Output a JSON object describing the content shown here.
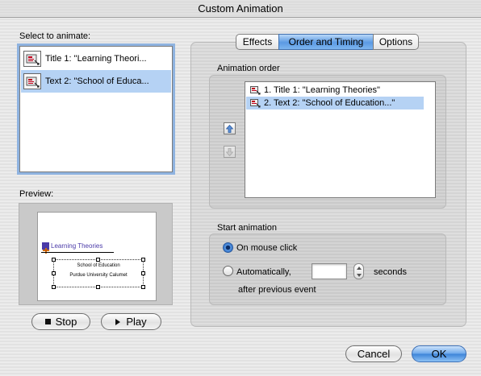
{
  "window": {
    "title": "Custom Animation"
  },
  "select": {
    "label": "Select to animate:",
    "items": [
      {
        "label": "Title 1: \"Learning Theori...",
        "selected": false
      },
      {
        "label": "Text 2: \"School of Educa...",
        "selected": true
      }
    ]
  },
  "preview": {
    "label": "Preview:",
    "slide_title": "Learning Theories",
    "slide_line1": "School of Education",
    "slide_line2": "Purdue University Calumet"
  },
  "buttons": {
    "stop": "Stop",
    "play": "Play",
    "cancel": "Cancel",
    "ok": "OK"
  },
  "tabs": [
    {
      "label": "Effects",
      "active": false
    },
    {
      "label": "Order and Timing",
      "active": true
    },
    {
      "label": "Options",
      "active": false
    }
  ],
  "order": {
    "label": "Animation order",
    "items": [
      {
        "label": "1. Title 1: \"Learning Theories\"",
        "selected": false
      },
      {
        "label": "2. Text 2: \"School of Education...\"",
        "selected": true
      }
    ],
    "move_up_icon": "arrow-up-icon",
    "move_down_icon": "arrow-down-icon"
  },
  "start": {
    "label": "Start animation",
    "on_click_label": "On mouse click",
    "auto_label": "Automatically,",
    "seconds_value": "",
    "seconds_label": "seconds",
    "after_label": "after previous event",
    "selected_option": "on_click"
  },
  "colors": {
    "accent": "#5b9ae3",
    "selection": "#b5d2f4",
    "slide_title": "#4a3aa8"
  }
}
